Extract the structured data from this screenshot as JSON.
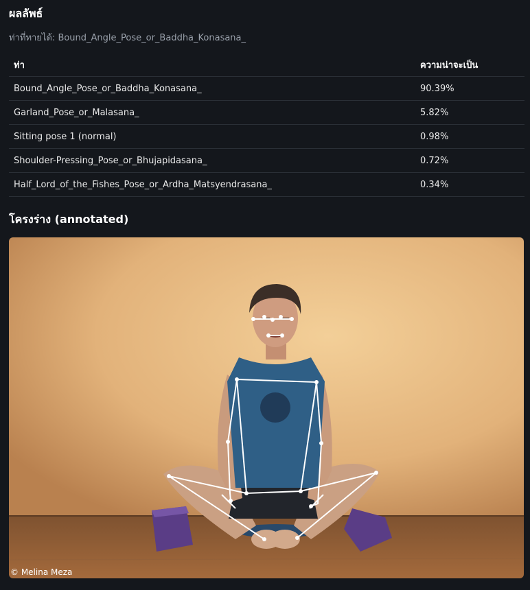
{
  "result": {
    "title": "ผลลัพธ์",
    "predicted_label": "ท่าที่ทายได้:",
    "predicted_value": "Bound_Angle_Pose_or_Baddha_Konasana_"
  },
  "table": {
    "headers": [
      "ท่า",
      "ความน่าจะเป็น"
    ],
    "rows": [
      [
        "Bound_Angle_Pose_or_Baddha_Konasana_",
        "90.39%"
      ],
      [
        "Garland_Pose_or_Malasana_",
        "5.82%"
      ],
      [
        "Sitting pose 1 (normal)",
        "0.98%"
      ],
      [
        "Shoulder-Pressing_Pose_or_Bhujapidasana_",
        "0.72%"
      ],
      [
        "Half_Lord_of_the_Fishes_Pose_or_Ardha_Matsyendrasana_",
        "0.34%"
      ]
    ]
  },
  "skeleton": {
    "title": "โครงร่าง (annotated)",
    "credit": "© Melina Meza"
  },
  "colors": {
    "background": "#14171c",
    "wall": "#e9bf86",
    "floor": "#8a5a32",
    "block": "#5a3d86",
    "shirt": "#2f5f86",
    "skeleton": "#ffffff"
  }
}
